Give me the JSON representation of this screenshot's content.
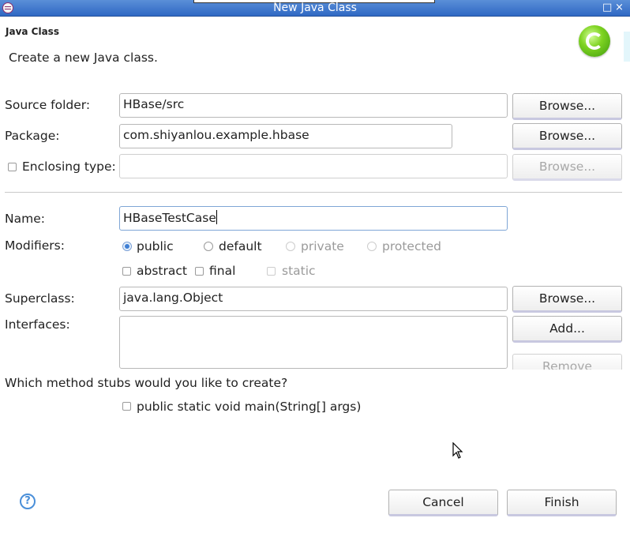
{
  "window": {
    "title": "New Java Class",
    "controls": [
      "□",
      "×"
    ]
  },
  "header": {
    "title": "Java Class",
    "description": "Create a new Java class."
  },
  "form": {
    "source_folder": {
      "label": "Source folder:",
      "value": "HBase/src",
      "browse": "Browse..."
    },
    "package": {
      "label": "Package:",
      "value": "com.shiyanlou.example.hbase",
      "browse": "Browse..."
    },
    "enclosing_type": {
      "label": "Enclosing type:",
      "value": "",
      "browse": "Browse...",
      "checked": false
    },
    "name": {
      "label": "Name:",
      "value": "HBaseTestCase"
    },
    "modifiers": {
      "label": "Modifiers:",
      "access": [
        {
          "label": "public",
          "selected": true,
          "enabled": true
        },
        {
          "label": "default",
          "selected": false,
          "enabled": true
        },
        {
          "label": "private",
          "selected": false,
          "enabled": false
        },
        {
          "label": "protected",
          "selected": false,
          "enabled": false
        }
      ],
      "flags": [
        {
          "label": "abstract",
          "checked": false,
          "enabled": true
        },
        {
          "label": "final",
          "checked": false,
          "enabled": true
        },
        {
          "label": "static",
          "checked": false,
          "enabled": false
        }
      ]
    },
    "superclass": {
      "label": "Superclass:",
      "value": "java.lang.Object",
      "browse": "Browse..."
    },
    "interfaces": {
      "label": "Interfaces:",
      "add": "Add...",
      "remove": "Remove"
    },
    "stubs": {
      "question": "Which method stubs would you like to create?",
      "main_option": "public static void main(String[] args)",
      "main_checked": false
    }
  },
  "footer": {
    "help": "?",
    "cancel": "Cancel",
    "finish": "Finish"
  },
  "colors": {
    "titlebar": "#2f68c4",
    "focus": "#7fa6d6",
    "radio_selected": "#3f7fd4"
  }
}
